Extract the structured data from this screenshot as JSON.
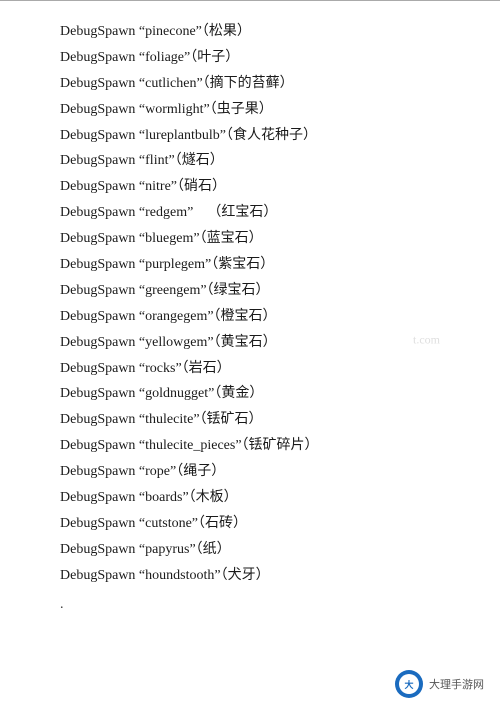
{
  "divider": true,
  "items": [
    {
      "command": "DebugSpawn",
      "key": "pinecone",
      "translation": "（松果）"
    },
    {
      "command": "DebugSpawn",
      "key": "foliage",
      "translation": "（叶子）"
    },
    {
      "command": "DebugSpawn",
      "key": "cutlichen",
      "translation": "（摘下的苔藓）"
    },
    {
      "command": "DebugSpawn",
      "key": "wormlight",
      "translation": "（虫子果）"
    },
    {
      "command": "DebugSpawn",
      "key": "lureplantbulb",
      "translation": "（食人花种子）"
    },
    {
      "command": "DebugSpawn",
      "key": "flint",
      "translation": "（燧石）"
    },
    {
      "command": "DebugSpawn",
      "key": "nitre",
      "translation": "（硝石）"
    },
    {
      "command": "DebugSpawn",
      "key": "redgem",
      "translation": "（红宝石）"
    },
    {
      "command": "DebugSpawn",
      "key": "bluegem",
      "translation": "（蓝宝石）"
    },
    {
      "command": "DebugSpawn",
      "key": "purplegem",
      "translation": "（紫宝石）"
    },
    {
      "command": "DebugSpawn",
      "key": "greengem",
      "translation": "（绿宝石）"
    },
    {
      "command": "DebugSpawn",
      "key": "orangegem",
      "translation": "（橙宝石）"
    },
    {
      "command": "DebugSpawn",
      "key": "yellowgem",
      "translation": "（黄宝石）"
    },
    {
      "command": "DebugSpawn",
      "key": "rocks",
      "translation": "（岩石）"
    },
    {
      "command": "DebugSpawn",
      "key": "goldnugget",
      "translation": "（黄金）"
    },
    {
      "command": "DebugSpawn",
      "key": "thulecite",
      "translation": "（铥矿石）"
    },
    {
      "command": "DebugSpawn",
      "key": "thulecite_pieces",
      "translation": "（铥矿碎片）"
    },
    {
      "command": "DebugSpawn",
      "key": "rope",
      "translation": "（绳子）"
    },
    {
      "command": "DebugSpawn",
      "key": "boards",
      "translation": "（木板）"
    },
    {
      "command": "DebugSpawn",
      "key": "cutstone",
      "translation": "（石砖）"
    },
    {
      "command": "DebugSpawn",
      "key": "papyrus",
      "translation": "（纸）"
    },
    {
      "command": "DebugSpawn",
      "key": "houndstooth",
      "translation": "（犬牙）"
    }
  ],
  "dot": ".",
  "watermark": "t.com",
  "footer": {
    "site": "大理手游网"
  }
}
